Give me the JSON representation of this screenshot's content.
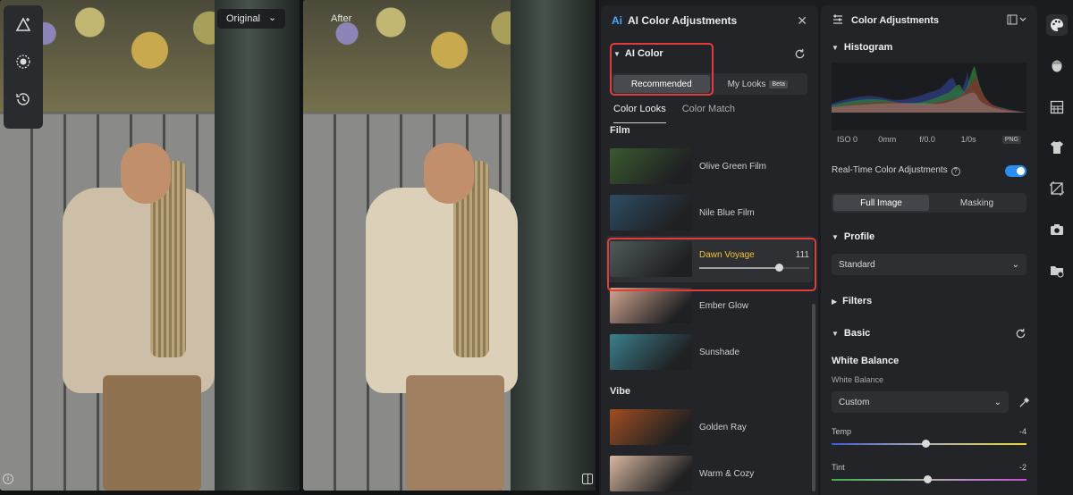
{
  "canvas": {
    "compare_mode": "Original",
    "after_label": "After"
  },
  "ai_panel": {
    "title": "AI Color Adjustments",
    "ai_logo": "Ai",
    "ai_color_label": "AI Color",
    "mode_tabs": [
      "Recommended",
      "My Looks"
    ],
    "beta_badge": "Beta",
    "sub_tabs": [
      "Color Looks",
      "Color Match"
    ],
    "groups": [
      {
        "title": "Film",
        "looks": [
          {
            "name": "Olive Green Film",
            "thumb": "#3a5a2f"
          },
          {
            "name": "Nile Blue Film",
            "thumb": "#2d4d63"
          },
          {
            "name": "Dawn Voyage",
            "thumb": "#4f5a58",
            "selected": true,
            "value": "111",
            "level": 0.72
          },
          {
            "name": "Ember Glow",
            "thumb": "#d2a58f"
          },
          {
            "name": "Sunshade",
            "thumb": "#3a7f8c"
          }
        ]
      },
      {
        "title": "Vibe",
        "looks": [
          {
            "name": "Golden Ray",
            "thumb": "#a04d22"
          },
          {
            "name": "Warm & Cozy",
            "thumb": "#d9b7a0"
          }
        ]
      }
    ]
  },
  "adj_panel": {
    "title": "Color Adjustments",
    "histogram_label": "Histogram",
    "meta": {
      "iso": "ISO 0",
      "focal": "0mm",
      "aperture": "f/0.0",
      "shutter": "1/0s",
      "format": "PNG"
    },
    "realtime_label": "Real-Time Color Adjustments",
    "realtime_on": true,
    "scope_tabs": [
      "Full Image",
      "Masking"
    ],
    "profile_label": "Profile",
    "profile_value": "Standard",
    "filters_label": "Filters",
    "basic_label": "Basic",
    "wb_title": "White Balance",
    "wb_sub": "White Balance",
    "wb_value": "Custom",
    "temp_label": "Temp",
    "temp_value": "-4",
    "temp_level": 0.48,
    "tint_label": "Tint",
    "tint_value": "-2",
    "tint_level": 0.49
  },
  "colors": {
    "accent": "#2a8ef0",
    "highlight_box": "#e03c3c",
    "selected_look_text": "#f1c232"
  }
}
